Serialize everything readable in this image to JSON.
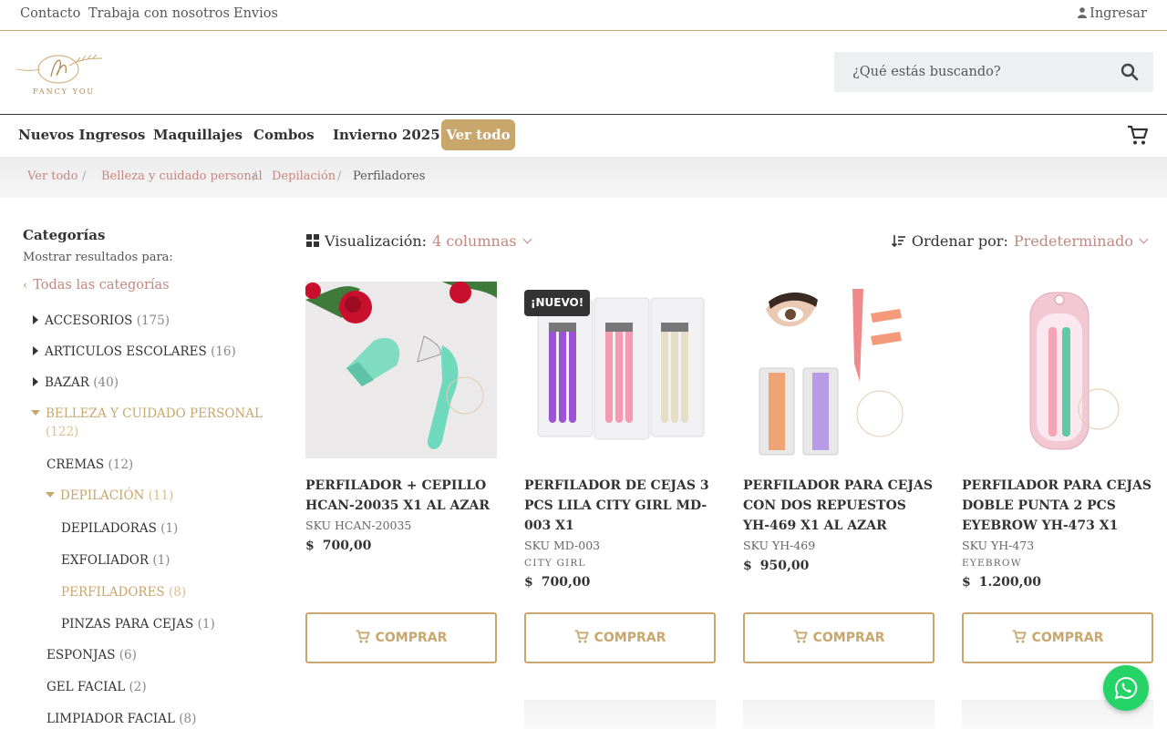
{
  "topbar": {
    "links": [
      "Contacto",
      "Trabaja con nosotros",
      "Envios"
    ],
    "login": "Ingresar"
  },
  "header": {
    "logo_text": "FANCY YOU",
    "search_placeholder": "¿Qué estás buscando?"
  },
  "nav": {
    "items": [
      "Nuevos Ingresos",
      "Maquillajes",
      "Combos",
      "Invierno 2025"
    ],
    "ver_todo": "Ver todo"
  },
  "breadcrumb": [
    "Ver todo",
    "Belleza y cuidado personal",
    "Depilación",
    "Perfiladores"
  ],
  "sidebar": {
    "title": "Categorías",
    "subtitle": "Mostrar resultados para:",
    "all": "Todas las categorías",
    "categories": [
      {
        "label": "ACCESORIOS",
        "count": "(175)"
      },
      {
        "label": "ARTICULOS ESCOLARES",
        "count": "(16)"
      },
      {
        "label": "BAZAR",
        "count": "(40)"
      },
      {
        "label": "BELLEZA Y CUIDADO PERSONAL",
        "count": "(122)"
      },
      {
        "label": "CREMAS",
        "count": "(12)"
      },
      {
        "label": "DEPILACIÓN",
        "count": "(11)"
      },
      {
        "label": "DEPILADORAS",
        "count": "(1)"
      },
      {
        "label": "EXFOLIADOR",
        "count": "(1)"
      },
      {
        "label": "PERFILADORES",
        "count": "(8)"
      },
      {
        "label": "PINZAS PARA CEJAS",
        "count": "(1)"
      },
      {
        "label": "ESPONJAS",
        "count": "(6)"
      },
      {
        "label": "GEL FACIAL",
        "count": "(2)"
      },
      {
        "label": "LIMPIADOR FACIAL",
        "count": "(8)"
      }
    ]
  },
  "toolbar": {
    "viz_label": "Visualización:",
    "viz_value": "4 columnas",
    "order_label": "Ordenar por:",
    "order_value": "Predeterminado"
  },
  "products": [
    {
      "name": "PERFILADOR + CEPILLO HCAN-20035 X1 AL AZAR",
      "sku": "SKU HCAN-20035",
      "brand": "",
      "currency": "$",
      "price": "700,00",
      "badge": ""
    },
    {
      "name": "PERFILADOR DE CEJAS 3 PCS LILA CITY GIRL MD-003 X1",
      "sku": "SKU MD-003",
      "brand": "CITY GIRL",
      "currency": "$",
      "price": "700,00",
      "badge": "¡NUEVO!"
    },
    {
      "name": "PERFILADOR PARA CEJAS CON DOS REPUESTOS YH-469 X1 AL AZAR",
      "sku": "SKU YH-469",
      "brand": "",
      "currency": "$",
      "price": "950,00",
      "badge": ""
    },
    {
      "name": "PERFILADOR PARA CEJAS DOBLE PUNTA 2 PCS EYEBROW YH-473 X1",
      "sku": "SKU YH-473",
      "brand": "EYEBROW",
      "currency": "$",
      "price": "1.200,00",
      "badge": ""
    }
  ],
  "buy_label": "COMPRAR",
  "colors": {
    "accent": "#c9a66b",
    "link": "#c4877f",
    "whatsapp": "#25d366"
  }
}
